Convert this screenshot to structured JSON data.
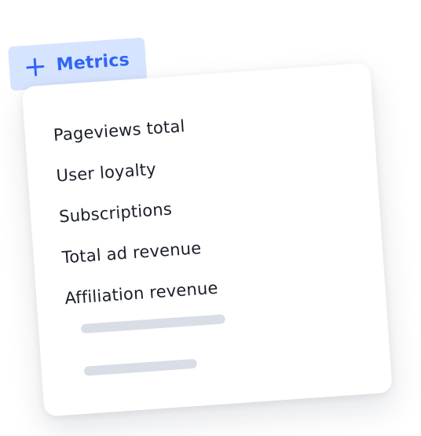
{
  "metrics_button": {
    "label": "Metrics",
    "icon": "plus-icon",
    "accent": "#2f66f5",
    "background": "#d6e4ff"
  },
  "menu": {
    "items": [
      {
        "label": "Pageviews total"
      },
      {
        "label": "User loyalty"
      },
      {
        "label": "Subscriptions"
      },
      {
        "label": "Total ad revenue"
      },
      {
        "label": "Affiliation revenue"
      }
    ],
    "placeholder_bar_color": "#d9dde6"
  }
}
